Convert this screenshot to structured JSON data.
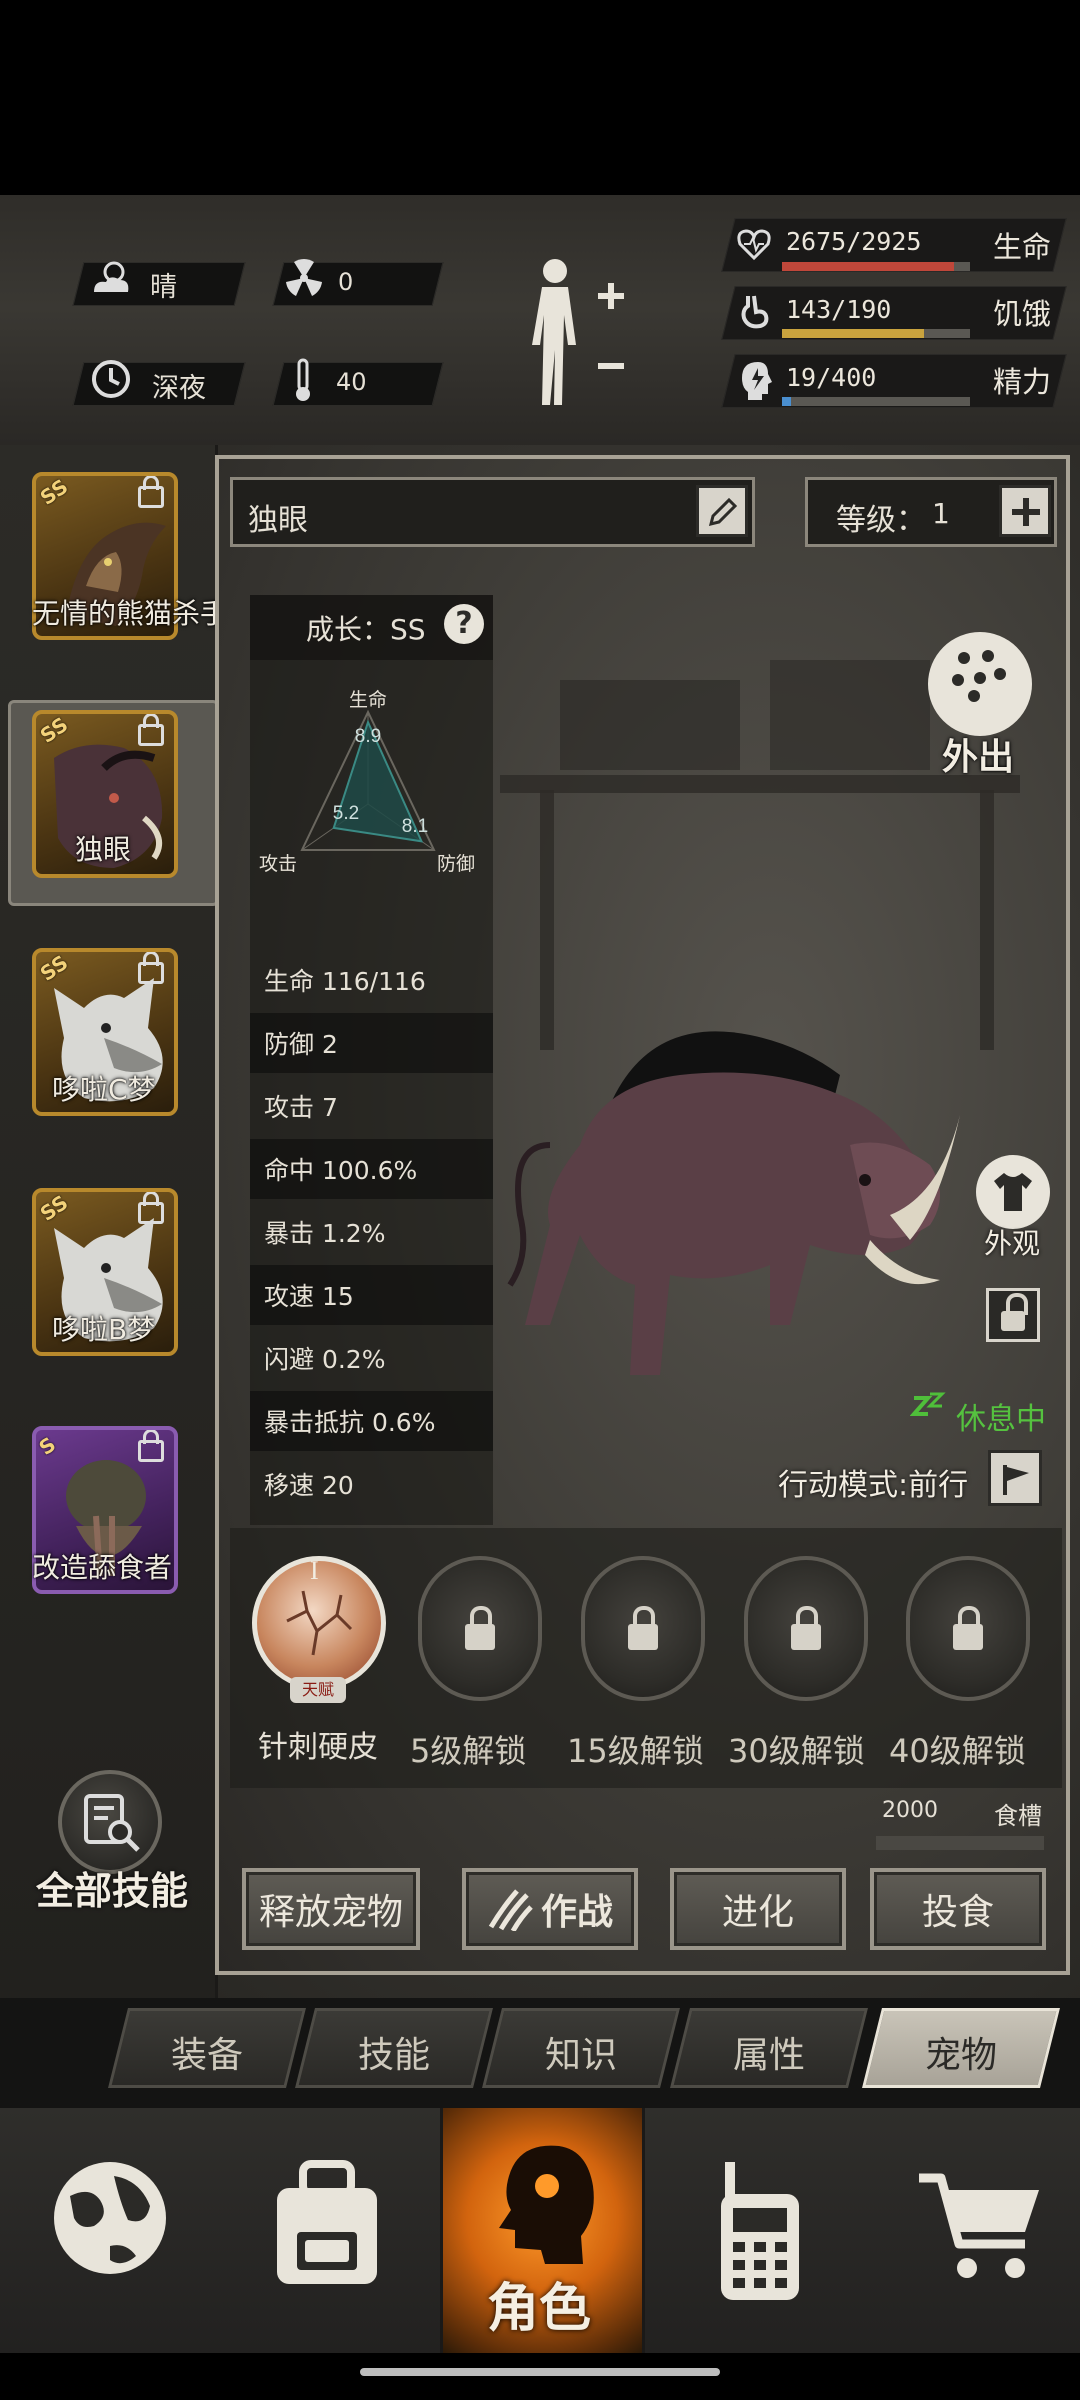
{
  "status": {
    "weather": "晴",
    "radiation": "0",
    "time_of_day": "深夜",
    "temperature": "40"
  },
  "vitals": [
    {
      "value": "2675/2925",
      "name": "生命",
      "fraction": 0.915,
      "color": "#c0473a"
    },
    {
      "value": "143/190",
      "name": "饥饿",
      "fraction": 0.753,
      "color": "#c9a33e"
    },
    {
      "value": "19/400",
      "name": "精力",
      "fraction": 0.048,
      "color": "#4a8fd0"
    }
  ],
  "pets": [
    {
      "rank": "SS",
      "name": "无情的熊猫杀手",
      "tier": "gold"
    },
    {
      "rank": "SS",
      "name": "独眼",
      "tier": "gold"
    },
    {
      "rank": "SS",
      "name": "哆啦C梦",
      "tier": "gold"
    },
    {
      "rank": "SS",
      "name": "哆啦B梦",
      "tier": "gold"
    },
    {
      "rank": "S",
      "name": "改造舔食者",
      "tier": "purple"
    }
  ],
  "all_skills_label": "全部技能",
  "pet_detail": {
    "name": "独眼",
    "level_label": "等级：",
    "level": "1",
    "growth": "成长：SS",
    "help_glyph": "?",
    "radar": {
      "life_label": "生命",
      "attack_label": "攻击",
      "defense_label": "防御",
      "life_value": "8.9",
      "attack_value": "5.2",
      "defense_value": "8.1",
      "life_score": 8.9,
      "attack_score": 5.2,
      "defense_score": 8.1,
      "max_score": 10
    },
    "stats": [
      "生命 116/116",
      "防御 2",
      "攻击 7",
      "命中 100.6%",
      "暴击 1.2%",
      "攻速 15",
      "闪避 0.2%",
      "暴击抵抗 0.6%",
      "移速 20"
    ],
    "go_out": "外出",
    "appearance": "外观",
    "status": "休息中",
    "action_mode": "行动模式:前行",
    "talent_badge": "天赋",
    "talent_roman": "I",
    "skills": [
      "针刺硬皮",
      "5级解锁",
      "15级解锁",
      "30级解锁",
      "40级解锁"
    ],
    "food_value": "2000",
    "food_label": "食槽",
    "buttons": [
      "释放宠物",
      "作战",
      "进化",
      "投食"
    ]
  },
  "tabs": [
    "装备",
    "技能",
    "知识",
    "属性",
    "宠物"
  ],
  "active_tab": "宠物",
  "nav": {
    "role_label": "角色"
  }
}
